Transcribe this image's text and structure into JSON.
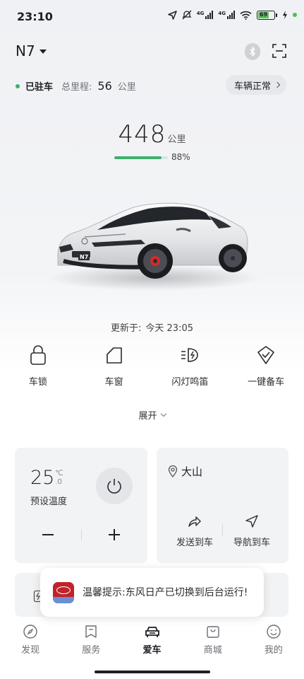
{
  "status_bar": {
    "time": "23:10",
    "network_1": "4G",
    "network_2": "4G",
    "battery": "69"
  },
  "header": {
    "model": "N7",
    "icons": [
      "bluetooth-icon",
      "scan-icon"
    ]
  },
  "vehicle": {
    "parked_status": "已驻车",
    "odometer_label": "总里程:",
    "odometer_value": "56",
    "odometer_unit": "公里",
    "health_status": "车辆正常",
    "range_value": "448",
    "range_unit": "公里",
    "battery_percent_label": "88%",
    "battery_fraction": 0.88,
    "car_badge": "N7",
    "updated_label": "更新于:",
    "updated_time": "今天 23:05"
  },
  "quick_actions": [
    {
      "label": "车锁",
      "icon": "lock-icon"
    },
    {
      "label": "车窗",
      "icon": "window-icon"
    },
    {
      "label": "闪灯鸣笛",
      "icon": "light-horn-icon"
    },
    {
      "label": "一键备车",
      "icon": "shield-check-icon"
    }
  ],
  "expand_label": "展开",
  "climate": {
    "temperature": "25",
    "unit_top": "℃",
    "unit_bottom": ".0",
    "label": "预设温度",
    "icons": [
      "power-icon",
      "minus-icon",
      "plus-icon"
    ]
  },
  "location": {
    "name": "大山",
    "send_label": "发送到车",
    "navigate_label": "导航到车"
  },
  "toast": {
    "text": "温馨提示:东风日产已切换到后台运行!"
  },
  "bottom_nav": [
    {
      "label": "发现",
      "icon": "compass-icon",
      "active": false
    },
    {
      "label": "服务",
      "icon": "service-icon",
      "active": false
    },
    {
      "label": "爱车",
      "icon": "car-icon",
      "active": true
    },
    {
      "label": "商城",
      "icon": "shop-icon",
      "active": false
    },
    {
      "label": "我的",
      "icon": "profile-icon",
      "active": false
    }
  ],
  "colors": {
    "accent_green": "#3fae6e",
    "battery_green": "#59c15d",
    "toast_icon_red": "#c0232a"
  }
}
